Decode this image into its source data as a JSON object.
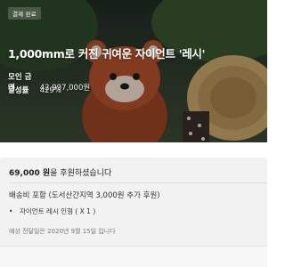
{
  "header": {
    "status_badge": "결제 완료",
    "title": "1,000mm로 커진 귀여운 자이언트 '레시'"
  },
  "stats": {
    "amount_label": "모인 금액",
    "amount_value": "42,997,000원",
    "rate_label": "달성률",
    "rate_value": "429%"
  },
  "pledge": {
    "amount": "69,000 원",
    "suffix": "을 후원하셨습니다",
    "shipping": "배송비 포함 (도서산간지역 3,000원 추가 후원)",
    "item_bullet": "•",
    "item": "자이언트 레시 인형 ( X 1 )",
    "delivery": "예상 전달일은 2020년 9월 15일 입니다"
  },
  "colors": {
    "hero_bg": "#2d3a2c",
    "panda_red": "#b5532a",
    "card_bg": "#f2f2f2"
  }
}
